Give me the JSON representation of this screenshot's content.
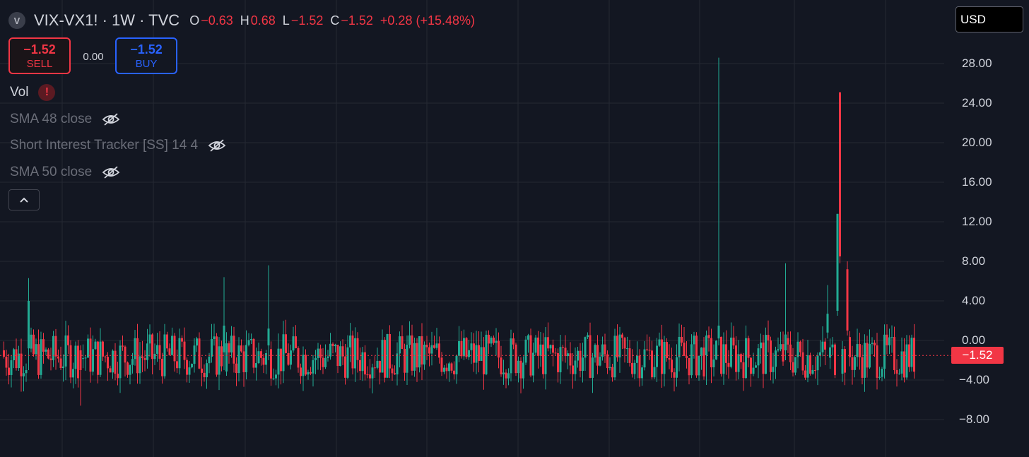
{
  "header": {
    "logo_letter": "V",
    "symbol": "VIX-VX1! · 1W · TVC",
    "open_label": "O",
    "open": "−0.63",
    "high_label": "H",
    "high": "0.68",
    "low_label": "L",
    "low": "−1.52",
    "close_label": "C",
    "close": "−1.52",
    "change": "+0.28 (+15.48%)"
  },
  "currency": "USD",
  "trade": {
    "sell_price": "−1.52",
    "sell_label": "SELL",
    "spread": "0.00",
    "buy_price": "−1.52",
    "buy_label": "BUY"
  },
  "indicators": [
    {
      "label": "Vol",
      "state": "warning"
    },
    {
      "label": "SMA 48 close",
      "state": "hidden"
    },
    {
      "label": "Short Interest Tracker [SS] 14 4",
      "state": "hidden"
    },
    {
      "label": "SMA 50 close",
      "state": "hidden"
    }
  ],
  "colors": {
    "up": "#22ab94",
    "down": "#f23645",
    "background": "#131722",
    "grid": "#242833"
  },
  "chart_data": {
    "type": "candlestick",
    "title": "VIX-VX1!",
    "interval": "1W",
    "ylim": [
      -11,
      32
    ],
    "yticks": [
      "28.00",
      "24.00",
      "20.00",
      "16.00",
      "12.00",
      "8.00",
      "4.00",
      "0.00",
      "−4.00",
      "−8.00"
    ],
    "last_price": -1.52,
    "last_price_label": "−1.52",
    "grid": true,
    "notable_points": [
      {
        "description": "max wick",
        "value": 28.6
      },
      {
        "description": "largest red candle high",
        "value": 25.1
      },
      {
        "description": "red candle body top",
        "value": 12.8
      }
    ],
    "candles": []
  }
}
